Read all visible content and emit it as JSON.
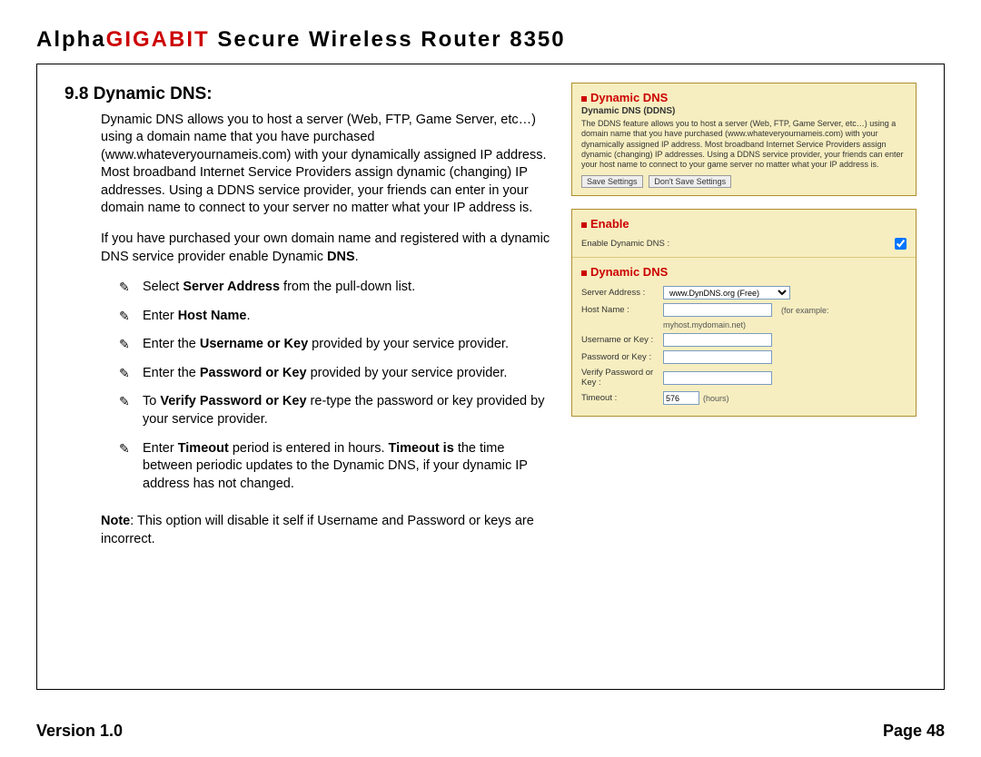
{
  "title": {
    "part1": "Alpha",
    "part2": "GIGABIT",
    "part3": " Secure Wireless Router 8350"
  },
  "section": {
    "heading": "9.8 Dynamic DNS:",
    "para1": "Dynamic DNS allows you to host a server (Web, FTP, Game Server, etc…) using a domain name that you have purchased (www.whateveryournameis.com) with your dynamically assigned IP address. Most broadband Internet Service Providers assign dynamic (changing) IP addresses. Using a DDNS service provider, your friends can enter in your domain name to connect to your server no matter what your IP address is.",
    "para2_a": "If you have purchased your own domain name and registered with a dynamic DNS service provider enable Dynamic ",
    "para2_b": "DNS",
    "para2_c": ".",
    "item1_a": "Select ",
    "item1_b": "Server Address",
    "item1_c": "  from the pull-down list.",
    "item2_a": "Enter ",
    "item2_b": "Host Name",
    "item2_c": ".",
    "item3_a": "Enter the ",
    "item3_b": "Username or Key",
    "item3_c": " provided by your service provider.",
    "item4_a": "Enter the ",
    "item4_b": "Password or Key",
    "item4_c": " provided by your service provider.",
    "item5_a": "To ",
    "item5_b": "Verify Password or Key",
    "item5_c": " re-type the password or key provided by your service provider.",
    "item6_a": "Enter ",
    "item6_b": "Timeout ",
    "item6_c": "period is entered in hours. ",
    "item6_d": "Timeout is ",
    "item6_e": "the time between periodic  updates to the Dynamic DNS, if your dynamic IP address has not changed.",
    "note_label": "Note",
    "note_sep": ":   ",
    "note_text": "This option will disable it self if Username and Password or keys are incorrect."
  },
  "panel": {
    "head_title": "Dynamic DNS",
    "head_sub": "Dynamic DNS (DDNS)",
    "head_desc": "The DDNS feature allows you to host a server (Web, FTP, Game Server, etc…) using a domain name that you have purchased (www.whateveryournameis.com) with your dynamically assigned IP address. Most broadband Internet Service Providers assign dynamic (changing) IP addresses. Using a DDNS service provider, your friends can enter your host name to connect to your game server no matter what your IP address is.",
    "btn_save": "Save Settings",
    "btn_dont": "Don't Save Settings",
    "enable_title": "Enable",
    "enable_label": "Enable Dynamic DNS :",
    "dyn_title": "Dynamic DNS",
    "lbl_server": "Server Address :",
    "val_server": "www.DynDNS.org (Free)",
    "lbl_host": "Host Name :",
    "host_example": "(for example: myhost.mydomain.net)",
    "lbl_user": "Username or Key :",
    "lbl_pass": "Password or Key :",
    "lbl_verify": "Verify Password or Key :",
    "lbl_timeout": "Timeout :",
    "val_timeout": "576",
    "timeout_unit": "(hours)"
  },
  "footer": {
    "version": "Version 1.0",
    "page": "Page 48"
  }
}
